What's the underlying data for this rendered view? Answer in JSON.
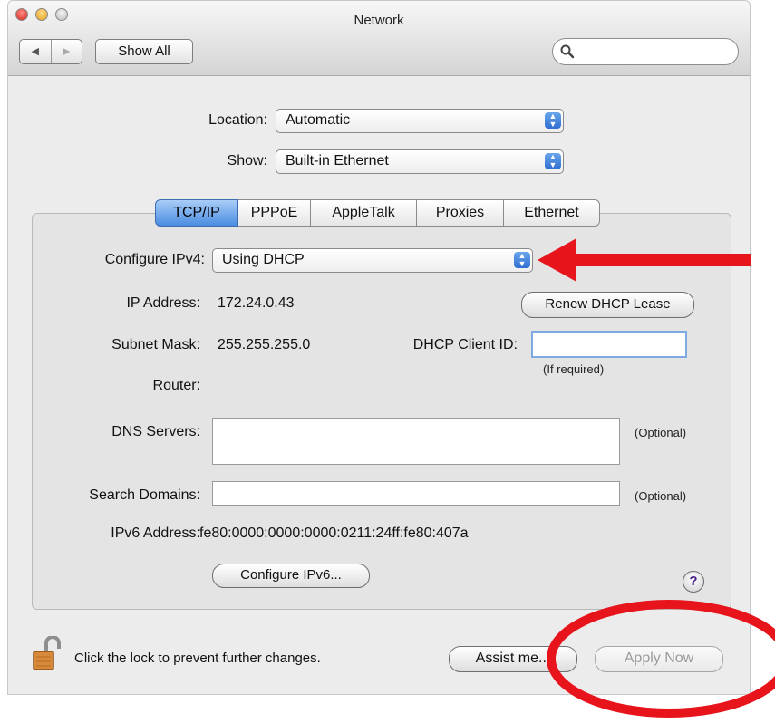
{
  "window": {
    "title": "Network"
  },
  "toolbar": {
    "back_glyph": "◀",
    "forward_glyph": "▶",
    "show_all_label": "Show All",
    "search_placeholder": ""
  },
  "location": {
    "label": "Location:",
    "value": "Automatic"
  },
  "show": {
    "label": "Show:",
    "value": "Built-in Ethernet"
  },
  "tabs": [
    {
      "label": "TCP/IP",
      "selected": true
    },
    {
      "label": "PPPoE",
      "selected": false
    },
    {
      "label": "AppleTalk",
      "selected": false
    },
    {
      "label": "Proxies",
      "selected": false
    },
    {
      "label": "Ethernet",
      "selected": false
    }
  ],
  "tcpip": {
    "configure_label": "Configure IPv4:",
    "configure_value": "Using DHCP",
    "ip_label": "IP Address:",
    "ip_value": "172.24.0.43",
    "renew_button": "Renew DHCP Lease",
    "subnet_label": "Subnet Mask:",
    "subnet_value": "255.255.255.0",
    "dhcp_client_label": "DHCP Client ID:",
    "dhcp_client_value": "",
    "dhcp_client_hint": "(If required)",
    "router_label": "Router:",
    "router_value": "",
    "dns_label": "DNS Servers:",
    "dns_value": "",
    "dns_hint": "(Optional)",
    "search_label": "Search Domains:",
    "search_value": "",
    "search_hint": "(Optional)",
    "ipv6_label": "IPv6 Address:",
    "ipv6_value": "fe80:0000:0000:0000:0211:24ff:fe80:407a",
    "configure_ipv6_button": "Configure IPv6...",
    "help_glyph": "?"
  },
  "footer": {
    "lock_text": "Click the lock to prevent further changes.",
    "assist_button": "Assist me...",
    "apply_button": "Apply Now"
  },
  "colors": {
    "annotation_red": "#e8141b",
    "tab_selected": "#4a8ce1",
    "stepper_blue": "#2f6ed1"
  }
}
